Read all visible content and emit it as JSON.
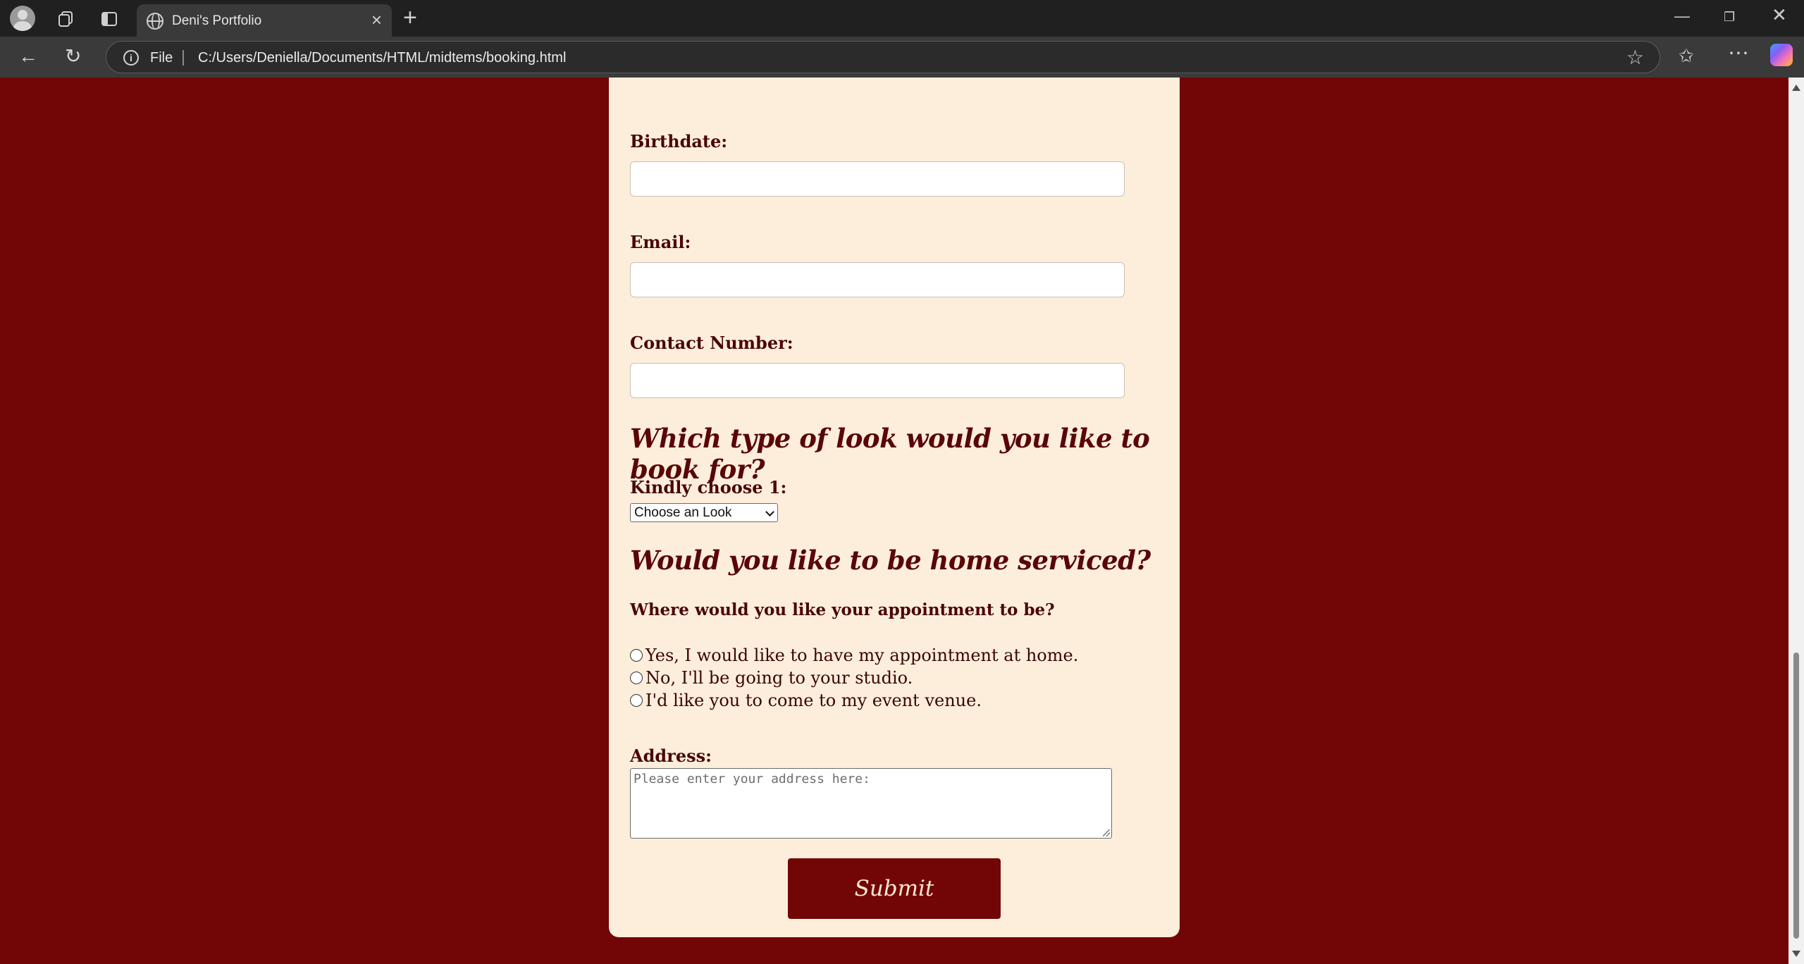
{
  "browser": {
    "tab_title": "Deni's Portfolio",
    "address_scheme": "File",
    "url": "C:/Users/Deniella/Documents/HTML/midtems/booking.html"
  },
  "form": {
    "birthdate_label": "Birthdate:",
    "email_label": "Email:",
    "contact_label": "Contact Number:",
    "look_heading": "Which type of look would you like to book for?",
    "choose_label": "Kindly choose 1:",
    "look_select_value": "Choose an Look",
    "home_heading": "Would you like to be home serviced?",
    "appointment_question": "Where would you like your appointment to be?",
    "options": [
      "Yes, I would like to have my appointment at home.",
      "No, I'll be going to your studio.",
      "I'd like you to come to my event venue."
    ],
    "address_label": "Address:",
    "address_placeholder": "Please enter your address here:",
    "submit_label": "Submit"
  },
  "colors": {
    "page_background": "#720606",
    "card_background": "#fdeedb",
    "heading_text": "#5a0606",
    "button_background": "#720606"
  }
}
